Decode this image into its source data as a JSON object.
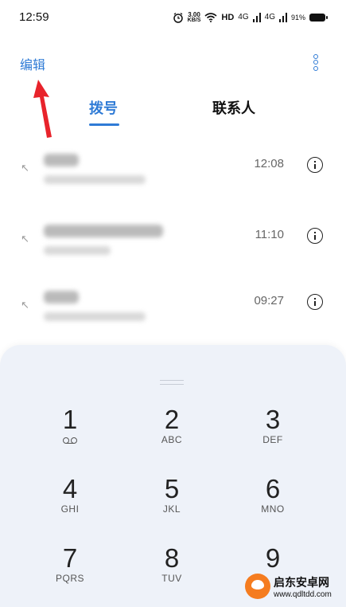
{
  "status_bar": {
    "time": "12:59",
    "speed_value": "3.00",
    "speed_unit": "KB/S",
    "hd": "HD",
    "net1": "4G",
    "net2": "4G",
    "battery": "91%"
  },
  "header": {
    "edit_label": "编辑"
  },
  "tabs": [
    {
      "label": "拨号",
      "active": true
    },
    {
      "label": "联系人",
      "active": false
    }
  ],
  "calls": [
    {
      "time": "12:08"
    },
    {
      "time": "11:10"
    },
    {
      "time": "09:27"
    }
  ],
  "dialpad": {
    "keys": [
      {
        "num": "1",
        "letters": ""
      },
      {
        "num": "2",
        "letters": "ABC"
      },
      {
        "num": "3",
        "letters": "DEF"
      },
      {
        "num": "4",
        "letters": "GHI"
      },
      {
        "num": "5",
        "letters": "JKL"
      },
      {
        "num": "6",
        "letters": "MNO"
      },
      {
        "num": "7",
        "letters": "PQRS"
      },
      {
        "num": "8",
        "letters": "TUV"
      },
      {
        "num": "9",
        "letters": ""
      }
    ]
  },
  "watermark": {
    "name": "启东安卓网",
    "url": "www.qdltdd.com"
  },
  "colors": {
    "accent": "#2f7bd6",
    "dialpad_bg": "#eef2f9",
    "annotation_arrow": "#e8232b"
  }
}
